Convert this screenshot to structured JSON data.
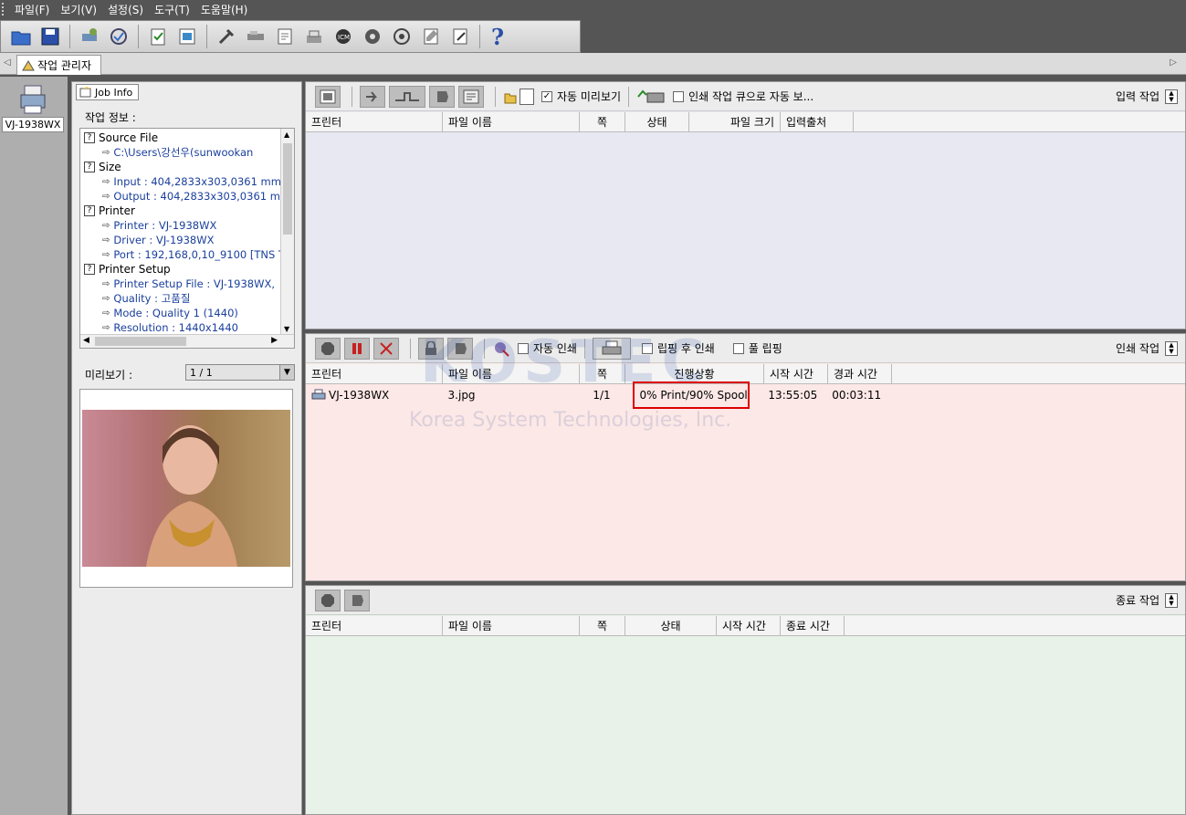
{
  "menu": [
    "파일(F)",
    "보기(V)",
    "설정(S)",
    "도구(T)",
    "도움말(H)"
  ],
  "toolbar_icons": [
    "open-folder-icon",
    "save-icon",
    "printer-setup-icon",
    "calibration-icon",
    "job-check-icon",
    "image-icon",
    "tools-icon",
    "cutter-icon",
    "document-icon",
    "stack-icon",
    "icc-icon",
    "color-icon",
    "target-icon",
    "notes-icon",
    "edit-icon",
    "help-icon"
  ],
  "main_tab": {
    "label": "작업 관리자"
  },
  "left_printer": {
    "label": "VJ-1938WX"
  },
  "job_info": {
    "tab_label": "Job Info",
    "title": "작업 정보 :",
    "tree": [
      {
        "type": "group",
        "label": "Source File"
      },
      {
        "type": "child",
        "label": "C:\\Users\\강선우(sunwookan"
      },
      {
        "type": "group",
        "label": "Size"
      },
      {
        "type": "child",
        "label": "Input : 404,2833x303,0361 mm"
      },
      {
        "type": "child",
        "label": "Output : 404,2833x303,0361 mm"
      },
      {
        "type": "group",
        "label": "Printer"
      },
      {
        "type": "child",
        "label": "Printer : VJ-1938WX"
      },
      {
        "type": "child",
        "label": "Driver : VJ-1938WX"
      },
      {
        "type": "child",
        "label": "Port : 192,168,0,10_9100 [TNS T"
      },
      {
        "type": "group",
        "label": "Printer Setup"
      },
      {
        "type": "child",
        "label": "Printer Setup File : VJ-1938WX,"
      },
      {
        "type": "child",
        "label": "Quality : 고품질"
      },
      {
        "type": "child",
        "label": "Mode : Quality 1 (1440)"
      },
      {
        "type": "child",
        "label": "Resolution : 1440x1440"
      }
    ],
    "preview_label": "미리보기 :",
    "page_select": "1 / 1"
  },
  "input_section": {
    "title": "입력 작업",
    "auto_preview_label": "자동 미리보기",
    "auto_preview_checked": true,
    "auto_print_queue_label": "인쇄 작업 큐으로 자동 보...",
    "auto_print_queue_checked": false,
    "columns": [
      "프린터",
      "파일 이름",
      "쪽",
      "상태",
      "파일 크기",
      "입력출처"
    ]
  },
  "print_section": {
    "title": "인쇄 작업",
    "auto_print_label": "자동 인쇄",
    "rip_then_print_label": "립핑 후 인쇄",
    "full_rip_label": "풀 립핑",
    "columns": [
      "프린터",
      "파일 이름",
      "쪽",
      "진행상황",
      "시작 시간",
      "경과 시간"
    ],
    "rows": [
      {
        "printer": "VJ-1938WX",
        "file": "3.jpg",
        "pages": "1/1",
        "progress": "0% Print/90% Spool",
        "start": "13:55:05",
        "elapsed": "00:03:11"
      }
    ]
  },
  "done_section": {
    "title": "종료 작업",
    "columns": [
      "프린터",
      "파일 이름",
      "쪽",
      "상태",
      "시작 시간",
      "종료 시간"
    ]
  },
  "watermark": {
    "line1": "KOSTEC",
    "line2": "Korea System Technologies, Inc."
  },
  "colors": {
    "input_bg": "#e8e8f2",
    "print_bg": "#fce8e6",
    "done_bg": "#e8f2e8",
    "highlight": "#dd0000"
  }
}
